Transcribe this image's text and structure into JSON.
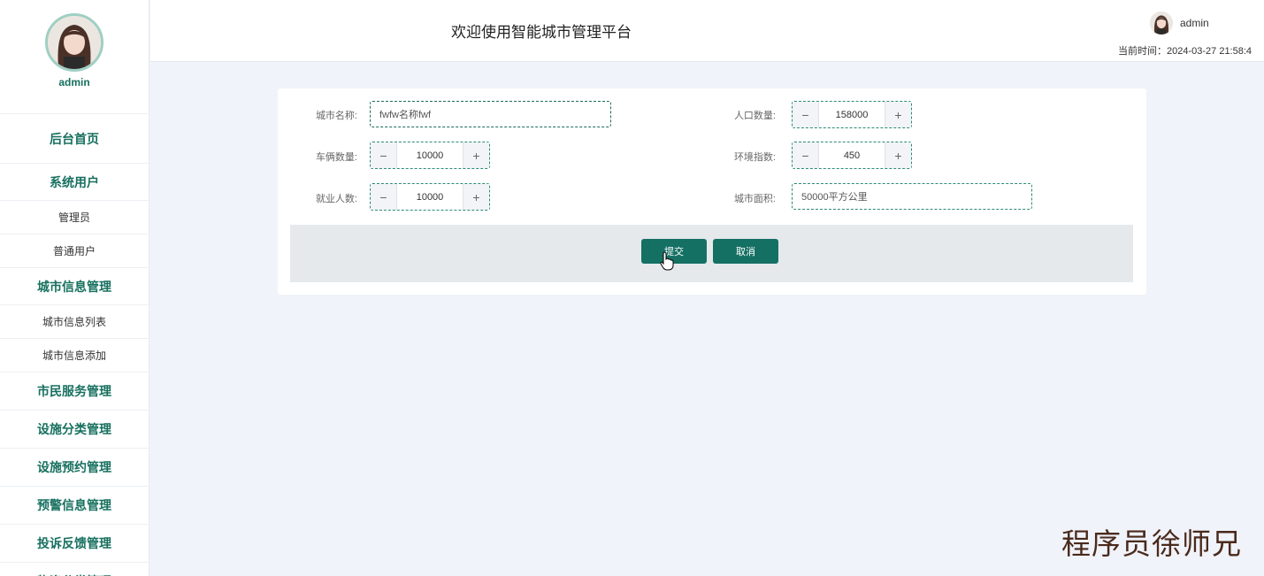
{
  "profile": {
    "name": "admin"
  },
  "sidebar": {
    "items": [
      {
        "label": "后台首页",
        "type": "group"
      },
      {
        "label": "系统用户",
        "type": "group"
      },
      {
        "label": "管理员",
        "type": "sub"
      },
      {
        "label": "普通用户",
        "type": "sub"
      },
      {
        "label": "城市信息管理",
        "type": "group"
      },
      {
        "label": "城市信息列表",
        "type": "sub"
      },
      {
        "label": "城市信息添加",
        "type": "sub"
      },
      {
        "label": "市民服务管理",
        "type": "group"
      },
      {
        "label": "设施分类管理",
        "type": "group"
      },
      {
        "label": "设施预约管理",
        "type": "group"
      },
      {
        "label": "预警信息管理",
        "type": "group"
      },
      {
        "label": "投诉反馈管理",
        "type": "group"
      },
      {
        "label": "物资分类管理",
        "type": "group"
      }
    ]
  },
  "header": {
    "title": "欢迎使用智能城市管理平台",
    "user": "admin",
    "time_label": "当前时间：",
    "time_value": "2024-03-27 21:58:4"
  },
  "form": {
    "city_name": {
      "label": "城市名称:",
      "value": "fwfw名称fwf"
    },
    "population": {
      "label": "人口数量:",
      "value": "158000"
    },
    "vehicles": {
      "label": "车俩数量:",
      "value": "10000"
    },
    "environment": {
      "label": "环境指数:",
      "value": "450"
    },
    "employment": {
      "label": "就业人数:",
      "value": "10000"
    },
    "area": {
      "label": "城市面积:",
      "value": "50000平方公里"
    },
    "minus_symbol": "−",
    "plus_symbol": "+",
    "submit_label": "提交",
    "cancel_label": "取消"
  },
  "watermark": "程序员徐师兄",
  "colors": {
    "accent": "#157064",
    "menu_text": "#17705f",
    "input_border": "#2b8a78"
  }
}
